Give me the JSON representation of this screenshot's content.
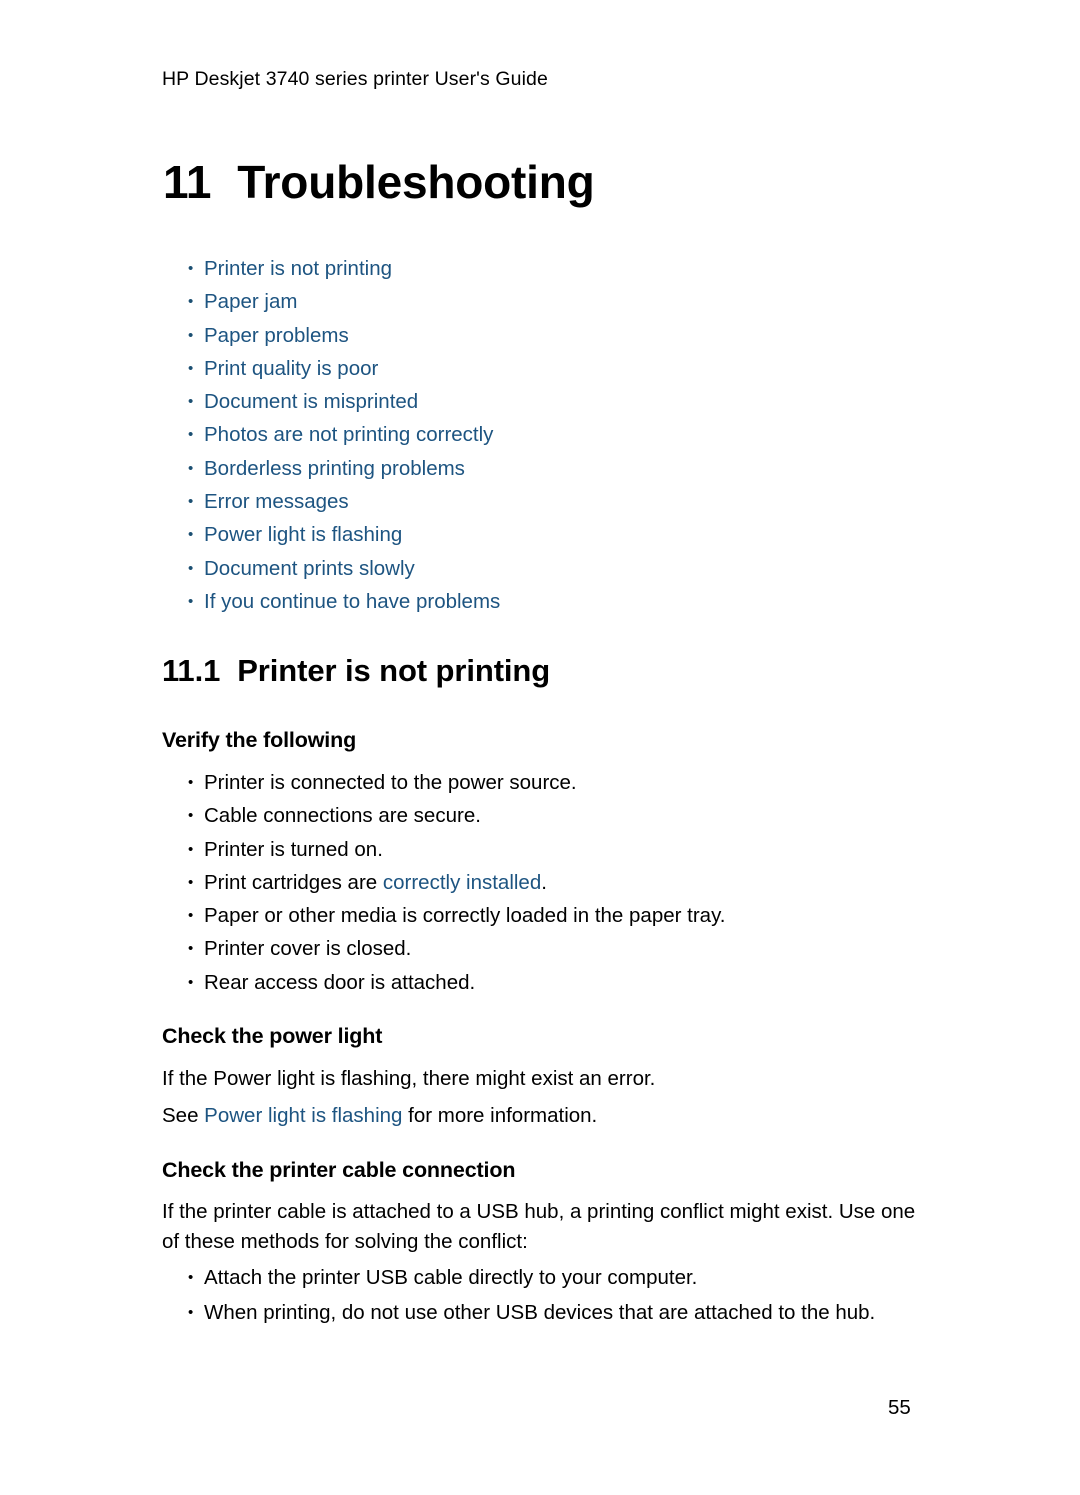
{
  "document": {
    "running_header": "HP Deskjet 3740 series printer User's Guide",
    "page_number": "55",
    "link_color": "#1d5481",
    "text_color": "#000000",
    "background_color": "#ffffff"
  },
  "chapter": {
    "number": "11",
    "title": "Troubleshooting"
  },
  "toc": {
    "items": [
      {
        "label": "Printer is not printing"
      },
      {
        "label": "Paper jam"
      },
      {
        "label": "Paper problems"
      },
      {
        "label": "Print quality is poor"
      },
      {
        "label": "Document is misprinted"
      },
      {
        "label": "Photos are not printing correctly"
      },
      {
        "label": "Borderless printing problems"
      },
      {
        "label": "Error messages"
      },
      {
        "label": "Power light is flashing"
      },
      {
        "label": "Document prints slowly"
      },
      {
        "label": "If you continue to have problems"
      }
    ]
  },
  "section": {
    "number": "11.1",
    "title": "Printer is not printing"
  },
  "verify": {
    "heading": "Verify the following",
    "items": [
      {
        "text": "Printer is connected to the power source."
      },
      {
        "text": "Cable connections are secure."
      },
      {
        "text": "Printer is turned on."
      },
      {
        "prefix": "Print cartridges are ",
        "link": "correctly installed",
        "suffix": "."
      },
      {
        "text": "Paper or other media is correctly loaded in the paper tray."
      },
      {
        "text": "Printer cover is closed."
      },
      {
        "text": "Rear access door is attached."
      }
    ]
  },
  "power_light": {
    "heading": "Check the power light",
    "paragraph_1": "If the Power light is flashing, there might exist an error.",
    "paragraph_2_prefix": "See ",
    "paragraph_2_link": "Power light is flashing",
    "paragraph_2_suffix": " for more information."
  },
  "cable": {
    "heading": "Check the printer cable connection",
    "paragraph": "If the printer cable is attached to a USB hub, a printing conflict might exist. Use one of these methods for solving the conflict:",
    "items": [
      {
        "text": "Attach the printer USB cable directly to your computer."
      },
      {
        "text": "When printing, do not use other USB devices that are attached to the hub."
      }
    ]
  }
}
